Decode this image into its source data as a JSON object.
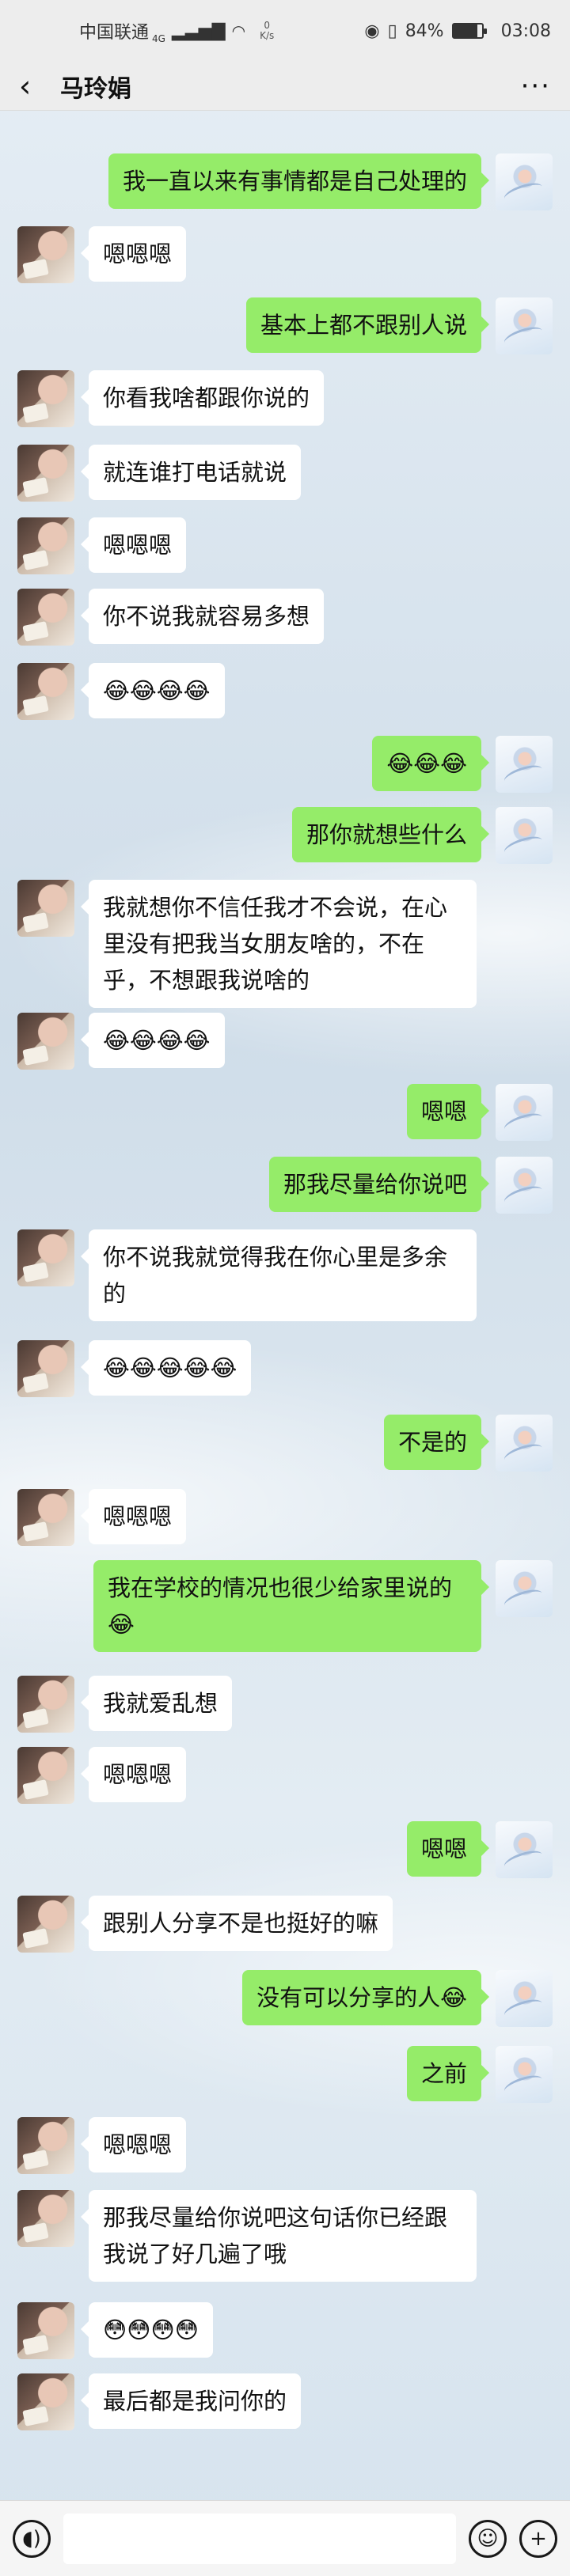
{
  "status_bar": {
    "carrier": "中国联通",
    "network": "4G",
    "speed_value": "0",
    "speed_unit": "K/s",
    "battery": "84%",
    "battery_level": 0.84,
    "time": "03:08"
  },
  "chat": {
    "title": "马玲娟",
    "back_icon": "chevron-left-icon",
    "more_icon": "more-icon"
  },
  "colors": {
    "outgoing_bubble": "#95ec69",
    "incoming_bubble": "#ffffff",
    "header_bg": "#ededed"
  },
  "messages": [
    {
      "side": "out",
      "text": "我一直以来有事情都是自己处理的"
    },
    {
      "side": "in",
      "text": "嗯嗯嗯"
    },
    {
      "side": "out",
      "text": "基本上都不跟别人说"
    },
    {
      "side": "in",
      "text": "你看我啥都跟你说的"
    },
    {
      "side": "in",
      "text": "就连谁打电话就说"
    },
    {
      "side": "in",
      "text": "嗯嗯嗯"
    },
    {
      "side": "in",
      "text": "你不说我就容易多想"
    },
    {
      "side": "in",
      "text": "😂😂😂😂"
    },
    {
      "side": "out",
      "text": "😂😂😂"
    },
    {
      "side": "out",
      "text": "那你就想些什么"
    },
    {
      "side": "in",
      "text": "我就想你不信任我才不会说，在心里没有把我当女朋友啥的，不在乎，不想跟我说啥的"
    },
    {
      "side": "in",
      "text": "😂😂😂😂"
    },
    {
      "side": "out",
      "text": "嗯嗯"
    },
    {
      "side": "out",
      "text": "那我尽量给你说吧"
    },
    {
      "side": "in",
      "text": "你不说我就觉得我在你心里是多余的"
    },
    {
      "side": "in",
      "text": "😂😂😂😂😂"
    },
    {
      "side": "out",
      "text": "不是的"
    },
    {
      "side": "in",
      "text": "嗯嗯嗯"
    },
    {
      "side": "out",
      "text": "我在学校的情况也很少给家里说的😂"
    },
    {
      "side": "in",
      "text": "我就爱乱想"
    },
    {
      "side": "in",
      "text": "嗯嗯嗯"
    },
    {
      "side": "out",
      "text": "嗯嗯"
    },
    {
      "side": "in",
      "text": "跟别人分享不是也挺好的嘛"
    },
    {
      "side": "out",
      "text": "没有可以分享的人😂"
    },
    {
      "side": "out",
      "text": "之前"
    },
    {
      "side": "in",
      "text": "嗯嗯嗯"
    },
    {
      "side": "in",
      "text": "那我尽量给你说吧这句话你已经跟我说了好几遍了哦"
    },
    {
      "side": "in",
      "text": "😳😳😳😳"
    },
    {
      "side": "in",
      "text": "最后都是我问你的"
    }
  ],
  "input_bar": {
    "voice_icon": "voice-icon",
    "emoji_icon": "emoji-icon",
    "plus_icon": "plus-icon",
    "value": ""
  }
}
